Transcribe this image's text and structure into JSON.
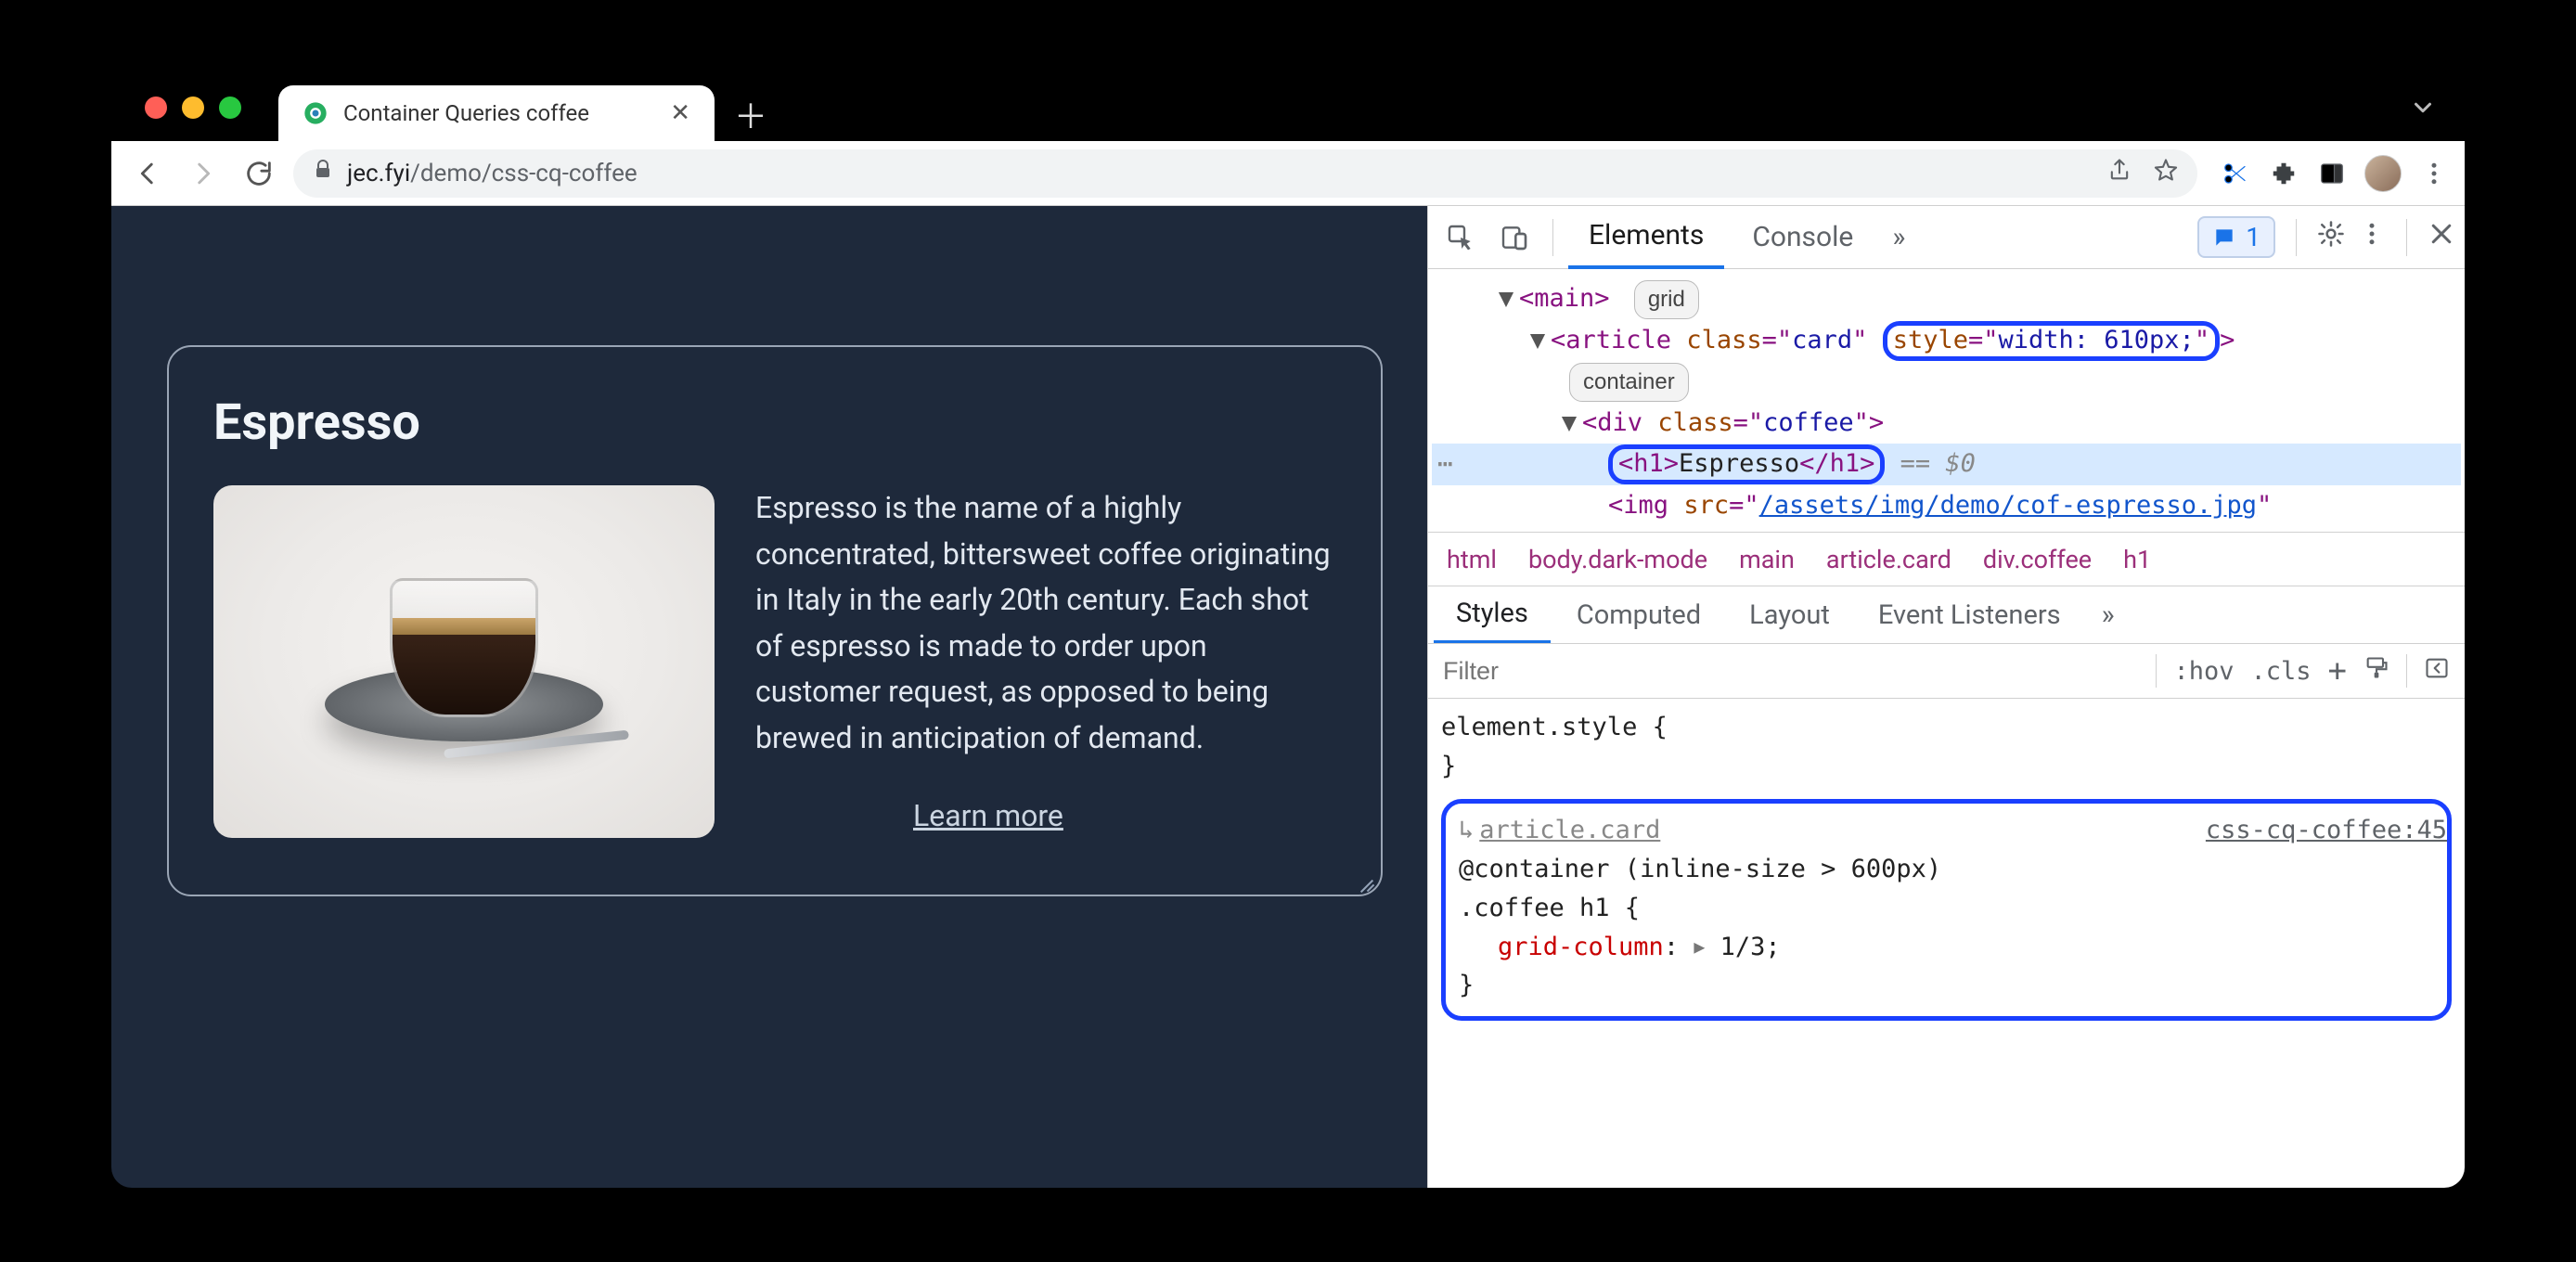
{
  "window": {
    "tab_title": "Container Queries coffee",
    "traffic": {
      "red": "#ff5f57",
      "yellow": "#febc2e",
      "green": "#28c840"
    }
  },
  "toolbar": {
    "nav": {
      "back": "Back",
      "forward": "Forward",
      "reload": "Reload"
    },
    "lock": "Secure",
    "url_host": "jec.fyi",
    "url_path": "/demo/css-cq-coffee",
    "actions": {
      "share": "Share",
      "bookmark": "Bookmark"
    },
    "ext": {
      "scissors": "Scissors extension",
      "puzzle": "Extensions",
      "panel": "Side panel"
    },
    "avatar": "Profile",
    "menu": "Chrome menu"
  },
  "page": {
    "card": {
      "title": "Espresso",
      "desc": "Espresso is the name of a highly concentrated, bittersweet coffee originating in Italy in the early 20th century. Each shot of espresso is made to order upon customer request, as opposed to being brewed in anticipation of demand.",
      "link": "Learn more",
      "img_alt": "Glass of espresso on a saucer"
    }
  },
  "devtools": {
    "tabs": {
      "elements": "Elements",
      "console": "Console",
      "more": "»"
    },
    "issues_count": "1",
    "dom": {
      "main_tag": "main",
      "main_badge": "grid",
      "article_open": "<article class=\"card\" ",
      "article_style_attr": "style",
      "article_style_val": "width: 610px;",
      "article_close": ">",
      "article_badge": "container",
      "div_open": "<div class=\"coffee\">",
      "h1_open": "<h1>",
      "h1_text": "Espresso",
      "h1_close": "</h1>",
      "h1_after": " == $0",
      "img_open": "<img src=\"",
      "img_src": "/assets/img/demo/cof-espresso.jpg",
      "img_close": "\""
    },
    "crumbs": [
      "html",
      "body.dark-mode",
      "main",
      "article.card",
      "div.coffee",
      "h1"
    ],
    "subtabs": {
      "styles": "Styles",
      "computed": "Computed",
      "layout": "Layout",
      "listeners": "Event Listeners",
      "more": "»"
    },
    "filter": {
      "placeholder": "Filter",
      "hov": ":hov",
      "cls": ".cls",
      "plus": "+"
    },
    "styles": {
      "element_style": "element.style {",
      "element_style_close": "}",
      "container_jump": "article.card",
      "container_query": "@container (inline-size > 600px)",
      "selector": ".coffee h1 {",
      "prop": "grid-column",
      "val": "1/3",
      "close": "}",
      "source_link": "css-cq-coffee:45"
    }
  }
}
